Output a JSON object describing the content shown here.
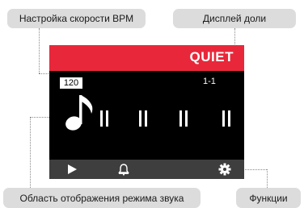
{
  "callouts": {
    "bpm": "Настройка скорости BPM",
    "beat": "Дисплей доли",
    "sound": "Область отображения режима звука",
    "functions": "Функции"
  },
  "screen": {
    "mode": "QUIET",
    "bpm": "120",
    "beat": "1-1",
    "mode_color": "#e8283a"
  },
  "icons": {
    "note": "eighth-note-icon",
    "play": "play-icon",
    "bell": "bell-icon",
    "gear": "gear-icon"
  }
}
